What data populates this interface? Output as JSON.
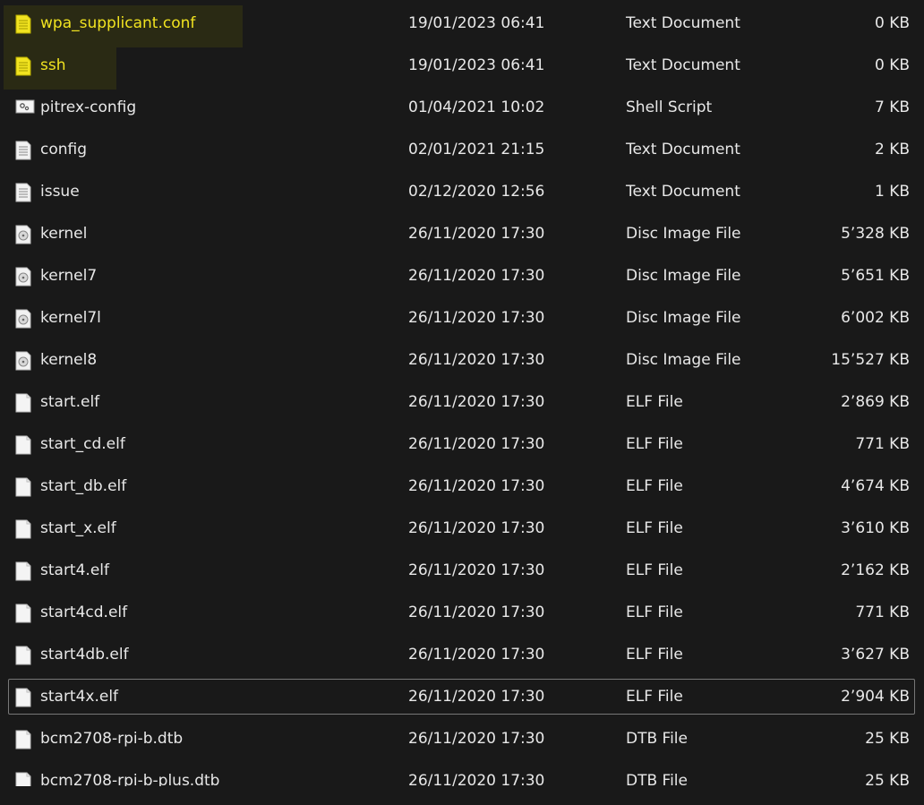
{
  "files": [
    {
      "name": "wpa_supplicant.conf",
      "date": "19/01/2023 06:41",
      "type": "Text Document",
      "size": "0 KB",
      "icon": "yellow-text-file-icon"
    },
    {
      "name": "ssh",
      "date": "19/01/2023 06:41",
      "type": "Text Document",
      "size": "0 KB",
      "icon": "yellow-text-file-icon"
    },
    {
      "name": "pitrex-config",
      "date": "01/04/2021 10:02",
      "type": "Shell Script",
      "size": "7 KB",
      "icon": "shell-script-icon"
    },
    {
      "name": "config",
      "date": "02/01/2021 21:15",
      "type": "Text Document",
      "size": "2 KB",
      "icon": "text-file-icon"
    },
    {
      "name": "issue",
      "date": "02/12/2020 12:56",
      "type": "Text Document",
      "size": "1 KB",
      "icon": "text-file-icon"
    },
    {
      "name": "kernel",
      "date": "26/11/2020 17:30",
      "type": "Disc Image File",
      "size": "5’328 KB",
      "icon": "disc-image-icon"
    },
    {
      "name": "kernel7",
      "date": "26/11/2020 17:30",
      "type": "Disc Image File",
      "size": "5’651 KB",
      "icon": "disc-image-icon"
    },
    {
      "name": "kernel7l",
      "date": "26/11/2020 17:30",
      "type": "Disc Image File",
      "size": "6’002 KB",
      "icon": "disc-image-icon"
    },
    {
      "name": "kernel8",
      "date": "26/11/2020 17:30",
      "type": "Disc Image File",
      "size": "15’527 KB",
      "icon": "disc-image-icon"
    },
    {
      "name": "start.elf",
      "date": "26/11/2020 17:30",
      "type": "ELF File",
      "size": "2’869 KB",
      "icon": "blank-file-icon"
    },
    {
      "name": "start_cd.elf",
      "date": "26/11/2020 17:30",
      "type": "ELF File",
      "size": "771 KB",
      "icon": "blank-file-icon"
    },
    {
      "name": "start_db.elf",
      "date": "26/11/2020 17:30",
      "type": "ELF File",
      "size": "4’674 KB",
      "icon": "blank-file-icon"
    },
    {
      "name": "start_x.elf",
      "date": "26/11/2020 17:30",
      "type": "ELF File",
      "size": "3’610 KB",
      "icon": "blank-file-icon"
    },
    {
      "name": "start4.elf",
      "date": "26/11/2020 17:30",
      "type": "ELF File",
      "size": "2’162 KB",
      "icon": "blank-file-icon"
    },
    {
      "name": "start4cd.elf",
      "date": "26/11/2020 17:30",
      "type": "ELF File",
      "size": "771 KB",
      "icon": "blank-file-icon"
    },
    {
      "name": "start4db.elf",
      "date": "26/11/2020 17:30",
      "type": "ELF File",
      "size": "3’627 KB",
      "icon": "blank-file-icon"
    },
    {
      "name": "start4x.elf",
      "date": "26/11/2020 17:30",
      "type": "ELF File",
      "size": "2’904 KB",
      "icon": "blank-file-icon",
      "focused": true
    },
    {
      "name": "bcm2708-rpi-b.dtb",
      "date": "26/11/2020 17:30",
      "type": "DTB File",
      "size": "25 KB",
      "icon": "blank-file-icon"
    },
    {
      "name": "bcm2708-rpi-b-plus.dtb",
      "date": "26/11/2020 17:30",
      "type": "DTB File",
      "size": "25 KB",
      "icon": "blank-file-icon"
    }
  ],
  "colors": {
    "background": "#191919",
    "text": "#e8e8e8",
    "highlight_marker": "#f1e320",
    "highlight_band": "#2a2a14",
    "focus_border": "#777777"
  }
}
